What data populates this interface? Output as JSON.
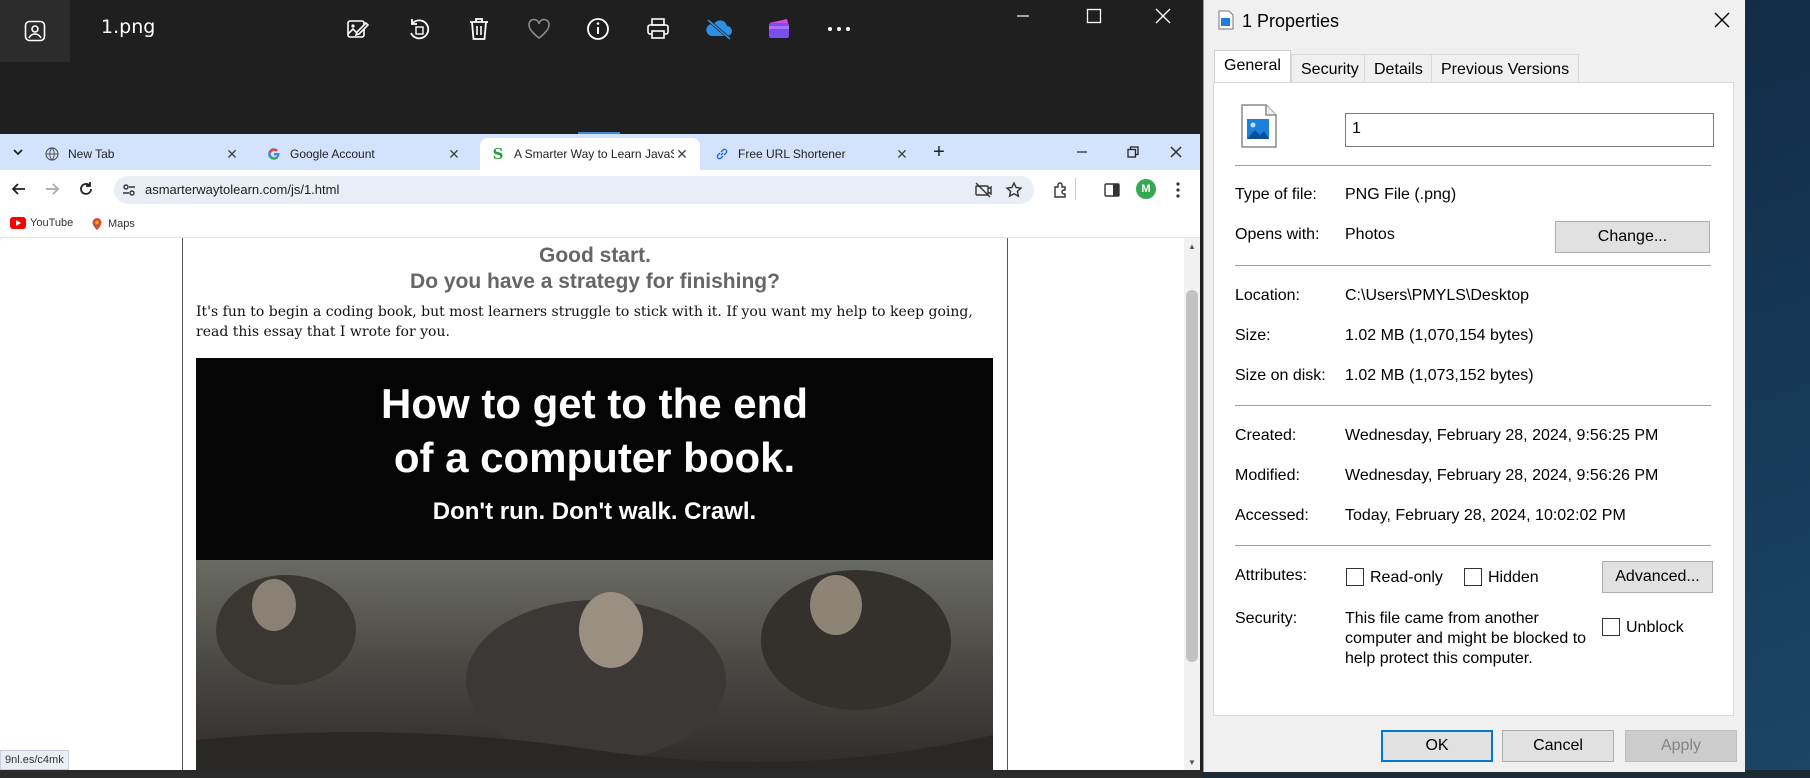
{
  "photos": {
    "filename": "1.png"
  },
  "browser": {
    "tabs": [
      {
        "title": "New Tab"
      },
      {
        "title": "Google Account"
      },
      {
        "title": "A Smarter Way to Learn JavaScri"
      },
      {
        "title": "Free URL Shortener"
      }
    ],
    "url": "asmarterwaytolearn.com/js/1.html",
    "avatar_letter": "M",
    "bookmarks": [
      "YouTube",
      "Maps"
    ],
    "page": {
      "heading1": "Good start.",
      "heading2": "Do you have a strategy for finishing?",
      "paragraph": "It's fun to begin a coding book, but most learners struggle to stick with it. If you want my help to keep going, read this essay that I wrote for you.",
      "banner_line1": "How to get to the end",
      "banner_line2": "of a computer book.",
      "banner_line3": "Don't run. Don't walk. Crawl."
    },
    "status_text": "9nl.es/c4mk"
  },
  "properties": {
    "title": "1 Properties",
    "tabs": [
      "General",
      "Security",
      "Details",
      "Previous Versions"
    ],
    "name_value": "1",
    "type_label": "Type of file:",
    "type_value": "PNG File (.png)",
    "opens_label": "Opens with:",
    "opens_value": "Photos",
    "change_label": "Change...",
    "location_label": "Location:",
    "location_value": "C:\\Users\\PMYLS\\Desktop",
    "size_label": "Size:",
    "size_value": "1.02 MB (1,070,154 bytes)",
    "size_disk_label": "Size on disk:",
    "size_disk_value": "1.02 MB (1,073,152 bytes)",
    "created_label": "Created:",
    "created_value": "Wednesday, February 28, 2024, 9:56:25 PM",
    "modified_label": "Modified:",
    "modified_value": "Wednesday, February 28, 2024, 9:56:26 PM",
    "accessed_label": "Accessed:",
    "accessed_value": "Today, February 28, 2024, 10:02:02 PM",
    "attributes_label": "Attributes:",
    "readonly_label": "Read-only",
    "hidden_label": "Hidden",
    "advanced_label": "Advanced...",
    "security_label": "Security:",
    "security_line1": "This file came from another",
    "security_line2": "computer and might be blocked to",
    "security_line3": "help protect this computer.",
    "unblock_label": "Unblock",
    "ok_label": "OK",
    "cancel_label": "Cancel",
    "apply_label": "Apply"
  },
  "colors": {
    "accent": "#0078d7",
    "chrome_tabbar": "#d3e3fd",
    "photos_bg": "#1f1f1f"
  }
}
